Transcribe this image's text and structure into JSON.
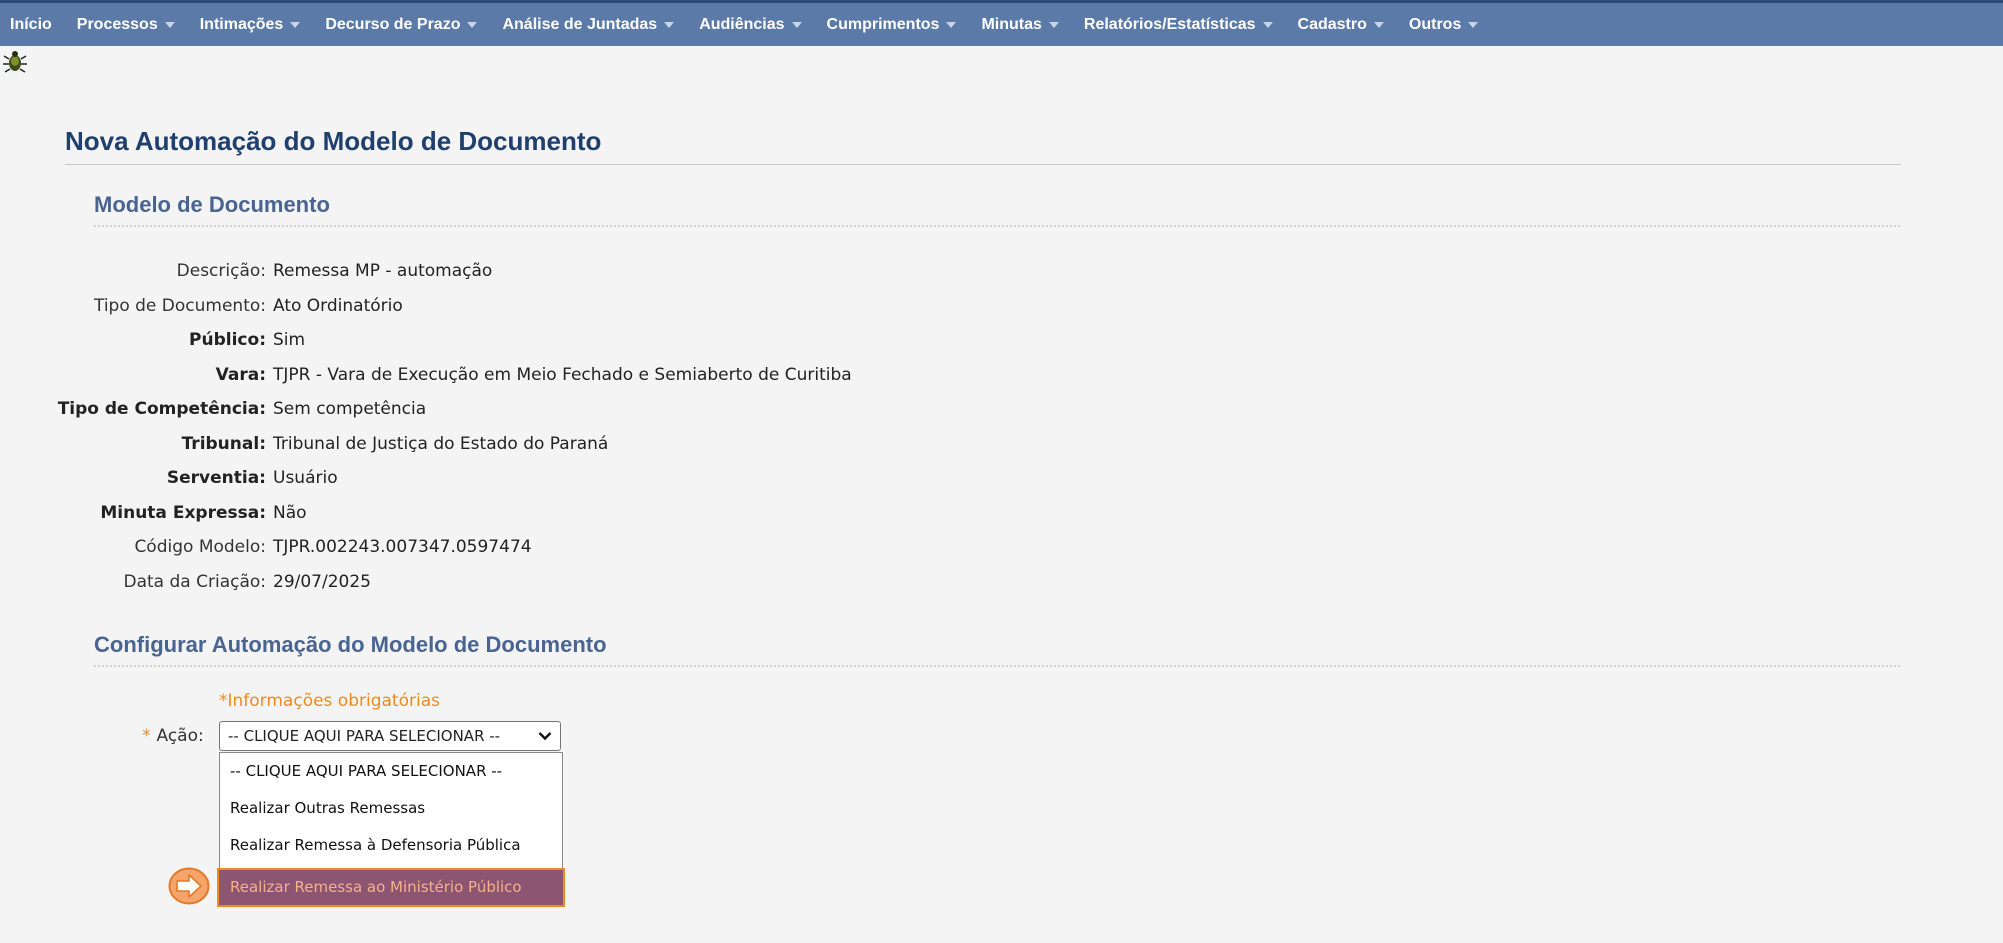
{
  "menu": [
    {
      "label": "Início",
      "dropdown": false
    },
    {
      "label": "Processos",
      "dropdown": true
    },
    {
      "label": "Intimações",
      "dropdown": true
    },
    {
      "label": "Decurso de Prazo",
      "dropdown": true
    },
    {
      "label": "Análise de Juntadas",
      "dropdown": true
    },
    {
      "label": "Audiências",
      "dropdown": true
    },
    {
      "label": "Cumprimentos",
      "dropdown": true
    },
    {
      "label": "Minutas",
      "dropdown": true
    },
    {
      "label": "Relatórios/Estatísticas",
      "dropdown": true
    },
    {
      "label": "Cadastro",
      "dropdown": true
    },
    {
      "label": "Outros",
      "dropdown": true
    }
  ],
  "page": {
    "title": "Nova Automação do Modelo de Documento"
  },
  "modelo": {
    "section_title": "Modelo de Documento",
    "fields": [
      {
        "label": "Descrição:",
        "value": "Remessa MP - automação",
        "bold": false
      },
      {
        "label": "Tipo de Documento:",
        "value": "Ato Ordinatório",
        "bold": false
      },
      {
        "label": "Público:",
        "value": "Sim",
        "bold": true
      },
      {
        "label": "Vara:",
        "value": "TJPR - Vara de Execução em Meio Fechado e Semiaberto de Curitiba",
        "bold": true
      },
      {
        "label": "Tipo de Competência:",
        "value": "Sem competência",
        "bold": true
      },
      {
        "label": "Tribunal:",
        "value": "Tribunal de Justiça do Estado do Paraná",
        "bold": true
      },
      {
        "label": "Serventia:",
        "value": "Usuário",
        "bold": true
      },
      {
        "label": "Minuta Expressa:",
        "value": "Não",
        "bold": true
      },
      {
        "label": "Código Modelo:",
        "value": "TJPR.002243.007347.0597474",
        "bold": false
      },
      {
        "label": "Data da Criação:",
        "value": "29/07/2025",
        "bold": false
      }
    ]
  },
  "config": {
    "section_title": "Configurar Automação do Modelo de Documento",
    "required_note": "*Informações obrigatórias",
    "acao_star": "*",
    "acao_label": "Ação:",
    "selected": "-- CLIQUE AQUI PARA SELECIONAR --",
    "options": [
      "-- CLIQUE AQUI PARA SELECIONAR --",
      "Realizar Outras Remessas",
      "Realizar Remessa à Defensoria Pública",
      "Realizar Remessa ao Ministério Público"
    ],
    "highlighted_index": 3
  },
  "colors": {
    "topbar": "#5b7aa8",
    "title": "#1f3f6e",
    "section": "#4a6491",
    "accent": "#f08a1c",
    "highlight_bg": "#8c5572"
  }
}
